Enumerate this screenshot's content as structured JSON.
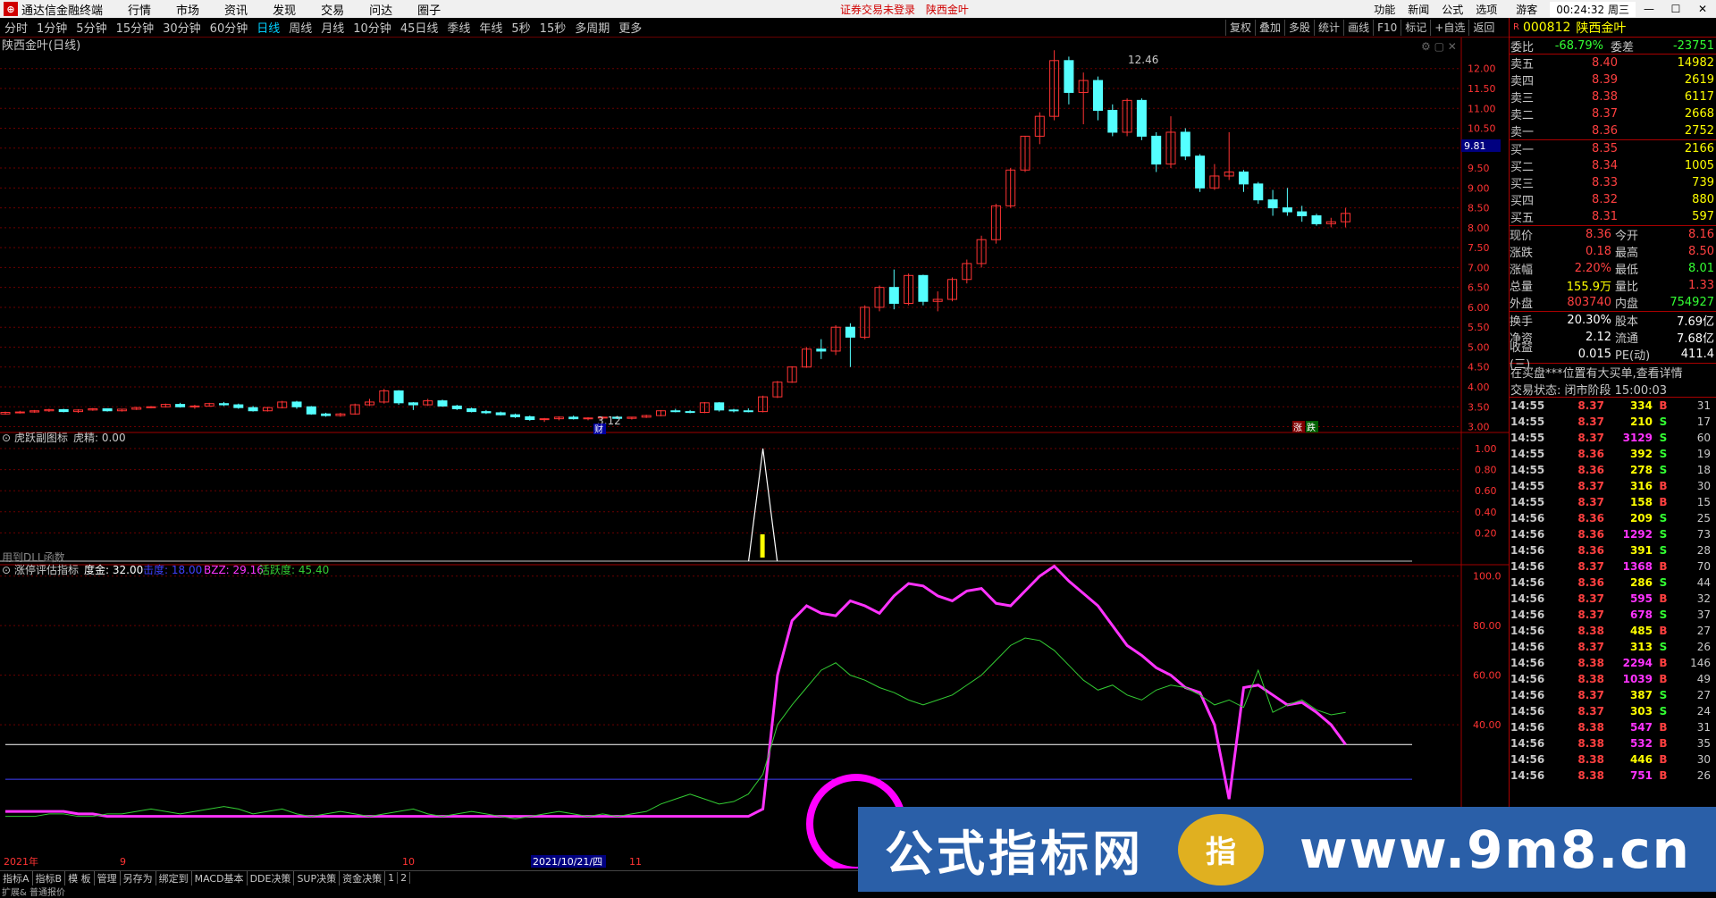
{
  "app": {
    "name": "通达信金融终端",
    "menu": [
      "行情",
      "市场",
      "资讯",
      "发现",
      "交易",
      "问达",
      "圈子"
    ],
    "login_notice": "证券交易未登录",
    "stock_title": "陕西金叶",
    "right_menu": [
      "功能",
      "新闻",
      "公式",
      "选项",
      "游客"
    ],
    "clock": "00:24:32 周三"
  },
  "periods": [
    "分时",
    "1分钟",
    "5分钟",
    "15分钟",
    "30分钟",
    "60分钟",
    "日线",
    "周线",
    "月线",
    "10分钟",
    "45日线",
    "季线",
    "年线",
    "5秒",
    "15秒",
    "多周期",
    "更多"
  ],
  "active_period": "日线",
  "tools": [
    "复权",
    "叠加",
    "多股",
    "统计",
    "画线",
    "F10",
    "标记",
    "+自选",
    "返回"
  ],
  "main_panel": {
    "title": "陕西金叶(日线)",
    "high_label": "12.46",
    "low_label": "3.12",
    "cross_price": "9.81",
    "cai_label": "财",
    "zhang_label": "涨",
    "die_label": "跌",
    "y_ticks": [
      "12.00",
      "11.50",
      "11.00",
      "10.50",
      "10.00",
      "9.50",
      "9.00",
      "8.50",
      "8.00",
      "7.50",
      "7.00",
      "6.50",
      "6.00",
      "5.50",
      "5.00",
      "4.50",
      "4.00",
      "3.50",
      "3.00"
    ]
  },
  "sub1": {
    "title": "虎跃副图标",
    "value_label": "虎精: 0.00",
    "dll_label": "用到DLL函数",
    "y_ticks": [
      "1.00",
      "0.80",
      "0.60",
      "0.40",
      "0.20"
    ]
  },
  "sub2": {
    "title": "涨停评估指标",
    "dujin": "度金: 32.00",
    "jiedu": "击度: 18.00",
    "bzz": "BZZ: 29.16",
    "huoyue": "活跃度: 45.40",
    "y_ticks": [
      "100.0",
      "80.00",
      "60.00",
      "40.00"
    ],
    "date_labels": [
      "2021年",
      "9",
      "10",
      "2021/10/21/四",
      "11"
    ]
  },
  "bottom_tabs": [
    "指标A",
    "指标B",
    "模 板",
    "管理",
    "另存为",
    "绑定到",
    "MACD基本",
    "DDE决策",
    "SUP决策",
    "资金决策",
    "1",
    "2"
  ],
  "bottom_line2": "扩展& 普通报价",
  "quote": {
    "code": "000812",
    "name": "陕西金叶",
    "r": "R",
    "weibi_label": "委比",
    "weibi": "-68.79%",
    "weicha_label": "委差",
    "weicha": "-23751",
    "asks": [
      {
        "label": "卖五",
        "price": "8.40",
        "vol": "14982"
      },
      {
        "label": "卖四",
        "price": "8.39",
        "vol": "2619"
      },
      {
        "label": "卖三",
        "price": "8.38",
        "vol": "6117"
      },
      {
        "label": "卖二",
        "price": "8.37",
        "vol": "2668"
      },
      {
        "label": "卖一",
        "price": "8.36",
        "vol": "2752"
      }
    ],
    "bids": [
      {
        "label": "买一",
        "price": "8.35",
        "vol": "2166"
      },
      {
        "label": "买二",
        "price": "8.34",
        "vol": "1005"
      },
      {
        "label": "买三",
        "price": "8.33",
        "vol": "739"
      },
      {
        "label": "买四",
        "price": "8.32",
        "vol": "880"
      },
      {
        "label": "买五",
        "price": "8.31",
        "vol": "597"
      }
    ],
    "stats1": [
      {
        "l1": "现价",
        "v1": "8.36",
        "l2": "今开",
        "v2": "8.16"
      },
      {
        "l1": "涨跌",
        "v1": "0.18",
        "l2": "最高",
        "v2": "8.50"
      },
      {
        "l1": "涨幅",
        "v1": "2.20%",
        "l2": "最低",
        "v2": "8.01"
      },
      {
        "l1": "总量",
        "v1": "155.9万",
        "l2": "量比",
        "v2": "1.33"
      },
      {
        "l1": "外盘",
        "v1": "803740",
        "l2": "内盘",
        "v2": "754927"
      }
    ],
    "stats2": [
      {
        "l1": "换手",
        "v1": "20.30%",
        "l2": "股本",
        "v2": "7.69亿"
      },
      {
        "l1": "净资",
        "v1": "2.12",
        "l2": "流通",
        "v2": "7.68亿"
      },
      {
        "l1": "收益(三)",
        "v1": "0.015",
        "l2": "PE(动)",
        "v2": "411.4"
      }
    ],
    "notice1": "在买盘***位置有大买单,查看详情",
    "notice2": "交易状态: 闭市阶段 15:00:03"
  },
  "ticks": [
    {
      "t": "14:55",
      "p": "8.37",
      "v": "334",
      "f": "B",
      "n": "31"
    },
    {
      "t": "14:55",
      "p": "8.37",
      "v": "210",
      "f": "S",
      "n": "17"
    },
    {
      "t": "14:55",
      "p": "8.37",
      "v": "3129",
      "f": "S",
      "n": "60"
    },
    {
      "t": "14:55",
      "p": "8.36",
      "v": "392",
      "f": "S",
      "n": "19"
    },
    {
      "t": "14:55",
      "p": "8.36",
      "v": "278",
      "f": "S",
      "n": "18"
    },
    {
      "t": "14:55",
      "p": "8.37",
      "v": "316",
      "f": "B",
      "n": "30"
    },
    {
      "t": "14:55",
      "p": "8.37",
      "v": "158",
      "f": "B",
      "n": "15"
    },
    {
      "t": "14:56",
      "p": "8.36",
      "v": "209",
      "f": "S",
      "n": "25"
    },
    {
      "t": "14:56",
      "p": "8.36",
      "v": "1292",
      "f": "S",
      "n": "73"
    },
    {
      "t": "14:56",
      "p": "8.36",
      "v": "391",
      "f": "S",
      "n": "28"
    },
    {
      "t": "14:56",
      "p": "8.37",
      "v": "1368",
      "f": "B",
      "n": "70"
    },
    {
      "t": "14:56",
      "p": "8.36",
      "v": "286",
      "f": "S",
      "n": "44"
    },
    {
      "t": "14:56",
      "p": "8.37",
      "v": "595",
      "f": "B",
      "n": "32"
    },
    {
      "t": "14:56",
      "p": "8.37",
      "v": "678",
      "f": "S",
      "n": "37"
    },
    {
      "t": "14:56",
      "p": "8.38",
      "v": "485",
      "f": "B",
      "n": "27"
    },
    {
      "t": "14:56",
      "p": "8.37",
      "v": "313",
      "f": "S",
      "n": "26"
    },
    {
      "t": "14:56",
      "p": "8.38",
      "v": "2294",
      "f": "B",
      "n": "146"
    },
    {
      "t": "14:56",
      "p": "8.38",
      "v": "1039",
      "f": "B",
      "n": "49"
    },
    {
      "t": "14:56",
      "p": "8.37",
      "v": "387",
      "f": "S",
      "n": "27"
    },
    {
      "t": "14:56",
      "p": "8.37",
      "v": "303",
      "f": "S",
      "n": "24"
    },
    {
      "t": "14:56",
      "p": "8.38",
      "v": "547",
      "f": "B",
      "n": "31"
    },
    {
      "t": "14:56",
      "p": "8.38",
      "v": "532",
      "f": "B",
      "n": "35"
    },
    {
      "t": "14:56",
      "p": "8.38",
      "v": "446",
      "f": "B",
      "n": "30"
    },
    {
      "t": "14:56",
      "p": "8.38",
      "v": "751",
      "f": "B",
      "n": "26"
    }
  ],
  "watermark": {
    "brand": "公式指标网",
    "site": "www.9m8.cn",
    "seal_text": "指"
  },
  "colors": {
    "up": "#ff3333",
    "down": "#54ffff",
    "magenta": "#ff33ff",
    "green": "#33cc33",
    "grid": "#8b0000"
  },
  "chart_data": {
    "type": "candlestick",
    "candles": [
      [
        3.32,
        3.38,
        3.3,
        3.36
      ],
      [
        3.36,
        3.4,
        3.33,
        3.37
      ],
      [
        3.37,
        3.42,
        3.35,
        3.4
      ],
      [
        3.4,
        3.45,
        3.37,
        3.43
      ],
      [
        3.43,
        3.45,
        3.36,
        3.38
      ],
      [
        3.38,
        3.44,
        3.35,
        3.42
      ],
      [
        3.42,
        3.47,
        3.4,
        3.45
      ],
      [
        3.45,
        3.46,
        3.38,
        3.4
      ],
      [
        3.4,
        3.45,
        3.38,
        3.44
      ],
      [
        3.44,
        3.5,
        3.42,
        3.48
      ],
      [
        3.48,
        3.52,
        3.46,
        3.5
      ],
      [
        3.5,
        3.58,
        3.48,
        3.56
      ],
      [
        3.56,
        3.6,
        3.48,
        3.5
      ],
      [
        3.5,
        3.55,
        3.45,
        3.52
      ],
      [
        3.52,
        3.6,
        3.5,
        3.58
      ],
      [
        3.58,
        3.62,
        3.52,
        3.55
      ],
      [
        3.55,
        3.58,
        3.45,
        3.48
      ],
      [
        3.48,
        3.52,
        3.38,
        3.4
      ],
      [
        3.4,
        3.5,
        3.38,
        3.48
      ],
      [
        3.48,
        3.65,
        3.46,
        3.62
      ],
      [
        3.62,
        3.65,
        3.45,
        3.5
      ],
      [
        3.5,
        3.52,
        3.3,
        3.32
      ],
      [
        3.32,
        3.35,
        3.25,
        3.28
      ],
      [
        3.28,
        3.35,
        3.25,
        3.32
      ],
      [
        3.32,
        3.58,
        3.3,
        3.55
      ],
      [
        3.55,
        3.7,
        3.52,
        3.62
      ],
      [
        3.62,
        3.95,
        3.58,
        3.9
      ],
      [
        3.9,
        3.92,
        3.55,
        3.6
      ],
      [
        3.6,
        3.62,
        3.42,
        3.55
      ],
      [
        3.55,
        3.7,
        3.52,
        3.65
      ],
      [
        3.65,
        3.68,
        3.5,
        3.52
      ],
      [
        3.52,
        3.55,
        3.42,
        3.45
      ],
      [
        3.45,
        3.48,
        3.36,
        3.38
      ],
      [
        3.38,
        3.42,
        3.32,
        3.35
      ],
      [
        3.35,
        3.38,
        3.28,
        3.3
      ],
      [
        3.3,
        3.33,
        3.22,
        3.25
      ],
      [
        3.25,
        3.28,
        3.15,
        3.18
      ],
      [
        3.18,
        3.22,
        3.12,
        3.2
      ],
      [
        3.2,
        3.26,
        3.16,
        3.24
      ],
      [
        3.24,
        3.28,
        3.18,
        3.2
      ],
      [
        3.2,
        3.24,
        3.16,
        3.22
      ],
      [
        3.22,
        3.26,
        3.18,
        3.24
      ],
      [
        3.24,
        3.27,
        3.19,
        3.21
      ],
      [
        3.21,
        3.25,
        3.18,
        3.24
      ],
      [
        3.24,
        3.3,
        3.22,
        3.28
      ],
      [
        3.28,
        3.42,
        3.26,
        3.4
      ],
      [
        3.4,
        3.45,
        3.36,
        3.38
      ],
      [
        3.38,
        3.42,
        3.34,
        3.36
      ],
      [
        3.36,
        3.62,
        3.34,
        3.6
      ],
      [
        3.6,
        3.62,
        3.38,
        3.42
      ],
      [
        3.42,
        3.45,
        3.36,
        3.4
      ],
      [
        3.4,
        3.46,
        3.36,
        3.38
      ],
      [
        3.38,
        3.78,
        3.36,
        3.75
      ],
      [
        3.75,
        4.15,
        3.72,
        4.12
      ],
      [
        4.12,
        4.52,
        4.1,
        4.5
      ],
      [
        4.5,
        5.0,
        4.48,
        4.95
      ],
      [
        4.95,
        5.2,
        4.7,
        4.9
      ],
      [
        4.9,
        5.55,
        4.8,
        5.5
      ],
      [
        5.5,
        5.6,
        4.5,
        5.25
      ],
      [
        5.25,
        6.05,
        5.2,
        6.0
      ],
      [
        6.0,
        6.55,
        5.9,
        6.5
      ],
      [
        6.5,
        6.95,
        5.95,
        6.1
      ],
      [
        6.1,
        6.85,
        6.05,
        6.8
      ],
      [
        6.8,
        6.82,
        6.05,
        6.15
      ],
      [
        6.15,
        6.4,
        5.9,
        6.2
      ],
      [
        6.2,
        6.75,
        6.15,
        6.7
      ],
      [
        6.7,
        7.2,
        6.6,
        7.1
      ],
      [
        7.1,
        7.8,
        7.0,
        7.7
      ],
      [
        7.7,
        8.6,
        7.6,
        8.55
      ],
      [
        8.55,
        9.5,
        8.5,
        9.45
      ],
      [
        9.45,
        10.3,
        9.4,
        10.3
      ],
      [
        10.3,
        10.9,
        10.1,
        10.8
      ],
      [
        10.8,
        12.46,
        10.7,
        12.2
      ],
      [
        12.2,
        12.3,
        11.1,
        11.4
      ],
      [
        11.4,
        11.9,
        10.6,
        11.7
      ],
      [
        11.7,
        11.8,
        10.7,
        10.95
      ],
      [
        10.95,
        11.1,
        10.3,
        10.4
      ],
      [
        10.4,
        11.25,
        10.3,
        11.2
      ],
      [
        11.2,
        11.25,
        10.2,
        10.3
      ],
      [
        10.3,
        10.4,
        9.4,
        9.6
      ],
      [
        9.6,
        10.8,
        9.5,
        10.4
      ],
      [
        10.4,
        10.5,
        9.7,
        9.8
      ],
      [
        9.8,
        9.85,
        8.9,
        9.0
      ],
      [
        9.0,
        9.6,
        8.95,
        9.3
      ],
      [
        9.3,
        10.4,
        9.2,
        9.4
      ],
      [
        9.4,
        9.45,
        8.9,
        9.1
      ],
      [
        9.1,
        9.15,
        8.6,
        8.7
      ],
      [
        8.7,
        8.95,
        8.3,
        8.5
      ],
      [
        8.5,
        9.0,
        8.3,
        8.4
      ],
      [
        8.4,
        8.55,
        8.15,
        8.3
      ],
      [
        8.3,
        8.35,
        8.05,
        8.1
      ],
      [
        8.1,
        8.25,
        8.01,
        8.15
      ],
      [
        8.15,
        8.5,
        8.01,
        8.36
      ]
    ],
    "ylim": [
      2.9,
      12.6
    ],
    "sub1_values": {
      "peak_index": 52,
      "peak": 1.0
    },
    "sub2_series": [
      {
        "name": "度金",
        "color": "#ffffff",
        "values": [
          32
        ]
      },
      {
        "name": "击度",
        "color": "#4040ff",
        "values": [
          18
        ]
      },
      {
        "name": "BZZ",
        "color": "#ff33ff",
        "values": [
          5,
          5,
          5,
          5,
          5,
          4,
          4,
          3,
          3,
          3,
          3,
          3,
          3,
          3,
          3,
          3,
          3,
          3,
          3,
          3,
          3,
          3,
          3,
          3,
          3,
          3,
          3,
          3,
          3,
          3,
          3,
          3,
          3,
          3,
          3,
          3,
          3,
          3,
          3,
          3,
          3,
          3,
          3,
          3,
          3,
          3,
          3,
          3,
          3,
          3,
          3,
          3,
          6,
          60,
          82,
          88,
          85,
          84,
          90,
          88,
          85,
          92,
          97,
          96,
          92,
          90,
          94,
          95,
          89,
          88,
          94,
          100,
          104,
          98,
          93,
          88,
          80,
          72,
          68,
          63,
          60,
          55,
          53,
          40,
          10,
          55,
          56,
          52,
          48,
          49,
          45,
          40,
          32
        ]
      },
      {
        "name": "活跃度",
        "color": "#33cc33",
        "values": [
          3,
          3,
          3,
          4,
          4,
          3,
          3,
          4,
          4,
          5,
          6,
          5,
          4,
          5,
          6,
          7,
          6,
          4,
          5,
          6,
          4,
          3,
          4,
          5,
          4,
          3,
          4,
          5,
          6,
          4,
          3,
          4,
          5,
          4,
          3,
          2,
          3,
          4,
          5,
          4,
          3,
          4,
          3,
          4,
          5,
          8,
          10,
          12,
          10,
          8,
          9,
          12,
          20,
          40,
          48,
          55,
          62,
          65,
          60,
          58,
          55,
          53,
          50,
          48,
          50,
          52,
          56,
          60,
          66,
          72,
          75,
          74,
          70,
          64,
          58,
          54,
          56,
          52,
          50,
          54,
          56,
          55,
          52,
          48,
          50,
          47,
          62,
          45,
          48,
          50,
          46,
          44,
          45
        ]
      }
    ]
  }
}
